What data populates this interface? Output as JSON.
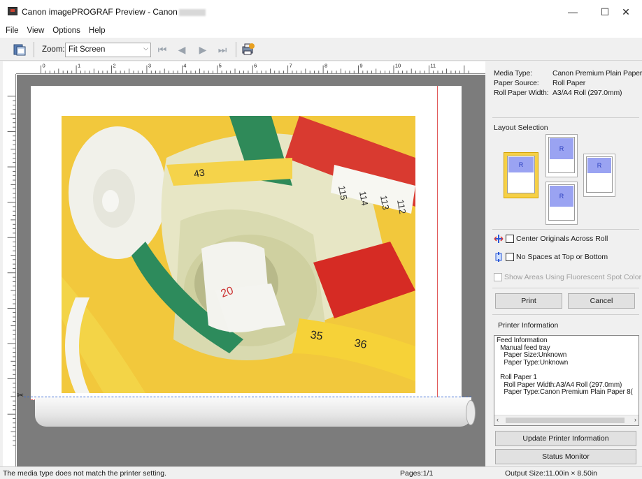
{
  "window": {
    "title": "Canon imagePROGRAF Preview - Canon",
    "minimize_glyph": "—",
    "maximize_glyph": "☐",
    "close_glyph": "✕"
  },
  "menu": [
    "File",
    "View",
    "Options",
    "Help"
  ],
  "toolbar": {
    "zoom_label": "Zoom:",
    "zoom_value": "Fit Screen",
    "icons": [
      "layout-preview-icon",
      "first-page-icon",
      "prev-page-icon",
      "next-page-icon",
      "last-page-icon",
      "printer-info-icon"
    ]
  },
  "ruler": {
    "h_labels": [
      "0",
      "1",
      "2",
      "3",
      "4",
      "5",
      "6",
      "7",
      "8",
      "9",
      "10",
      "11"
    ]
  },
  "media": {
    "media_type_label": "Media Type:",
    "media_type_value": "Canon Premium Plain Paper",
    "paper_source_label": "Paper Source:",
    "paper_source_value": "Roll Paper",
    "roll_width_label": "Roll Paper Width:",
    "roll_width_value": "A3/A4 Roll (297.0mm)"
  },
  "layout": {
    "title": "Layout Selection",
    "options": [
      "R",
      "R",
      "R",
      "R"
    ]
  },
  "options": {
    "center": "Center Originals Across Roll",
    "no_spaces": "No Spaces at Top or Bottom",
    "fluorescent": "Show Areas Using Fluorescent Spot Color"
  },
  "buttons": {
    "print": "Print",
    "cancel": "Cancel",
    "update": "Update Printer Information",
    "status_monitor": "Status Monitor"
  },
  "printer_info": {
    "title": "Printer Information",
    "text": "Feed Information\n  Manual feed tray\n    Paper Size:Unknown\n    Paper Type:Unknown\n\n  Roll Paper 1\n    Roll Paper Width:A3/A4 Roll (297.0mm)\n    Paper Type:Canon Premium Plain Paper 8("
  },
  "status": {
    "message": "The media type does not match the printer setting.",
    "pages": "Pages:1/1",
    "output_size": "Output Size:11.00in × 8.50in"
  },
  "colors": {
    "accent_yellow": "#f6d046",
    "layout_blue": "#9aa3f2",
    "margin_red": "#e05a5a",
    "cut_blue": "#3a6ad4",
    "canvas_gray": "#7c7c7c"
  }
}
